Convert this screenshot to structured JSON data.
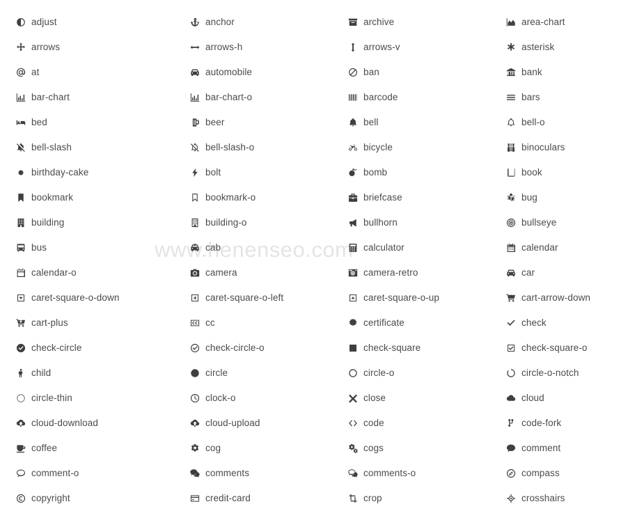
{
  "page": {
    "title": "Font Awesome icon cheatsheet",
    "background_color": "#ffffff",
    "text_color": "#4b4b4b",
    "icon_color": "#3f3f3f",
    "columns": 4,
    "rows": 20
  },
  "watermark": {
    "text": "www.henenseo.com",
    "color": "#e4e4e4"
  },
  "icons": [
    {
      "name": "adjust",
      "glyph": "adjust-icon",
      "row": 1,
      "col": 1
    },
    {
      "name": "anchor",
      "glyph": "anchor-icon",
      "row": 1,
      "col": 2
    },
    {
      "name": "archive",
      "glyph": "archive-icon",
      "row": 1,
      "col": 3
    },
    {
      "name": "area-chart",
      "glyph": "area-chart-icon",
      "row": 1,
      "col": 4
    },
    {
      "name": "arrows",
      "glyph": "arrows-icon",
      "row": 2,
      "col": 1
    },
    {
      "name": "arrows-h",
      "glyph": "arrows-h-icon",
      "row": 2,
      "col": 2
    },
    {
      "name": "arrows-v",
      "glyph": "arrows-v-icon",
      "row": 2,
      "col": 3
    },
    {
      "name": "asterisk",
      "glyph": "asterisk-icon",
      "row": 2,
      "col": 4
    },
    {
      "name": "at",
      "glyph": "at-icon",
      "row": 3,
      "col": 1
    },
    {
      "name": "automobile",
      "glyph": "automobile-icon",
      "row": 3,
      "col": 2
    },
    {
      "name": "ban",
      "glyph": "ban-icon",
      "row": 3,
      "col": 3
    },
    {
      "name": "bank",
      "glyph": "bank-icon",
      "row": 3,
      "col": 4
    },
    {
      "name": "bar-chart",
      "glyph": "bar-chart-icon",
      "row": 4,
      "col": 1
    },
    {
      "name": "bar-chart-o",
      "glyph": "bar-chart-o-icon",
      "row": 4,
      "col": 2
    },
    {
      "name": "barcode",
      "glyph": "barcode-icon",
      "row": 4,
      "col": 3
    },
    {
      "name": "bars",
      "glyph": "bars-icon",
      "row": 4,
      "col": 4
    },
    {
      "name": "bed",
      "glyph": "bed-icon",
      "row": 5,
      "col": 1
    },
    {
      "name": "beer",
      "glyph": "beer-icon",
      "row": 5,
      "col": 2
    },
    {
      "name": "bell",
      "glyph": "bell-icon",
      "row": 5,
      "col": 3
    },
    {
      "name": "bell-o",
      "glyph": "bell-o-icon",
      "row": 5,
      "col": 4
    },
    {
      "name": "bell-slash",
      "glyph": "bell-slash-icon",
      "row": 6,
      "col": 1
    },
    {
      "name": "bell-slash-o",
      "glyph": "bell-slash-o-icon",
      "row": 6,
      "col": 2
    },
    {
      "name": "bicycle",
      "glyph": "bicycle-icon",
      "row": 6,
      "col": 3
    },
    {
      "name": "binoculars",
      "glyph": "binoculars-icon",
      "row": 6,
      "col": 4
    },
    {
      "name": "birthday-cake",
      "glyph": "birthday-cake-icon",
      "row": 7,
      "col": 1
    },
    {
      "name": "bolt",
      "glyph": "bolt-icon",
      "row": 7,
      "col": 2
    },
    {
      "name": "bomb",
      "glyph": "bomb-icon",
      "row": 7,
      "col": 3
    },
    {
      "name": "book",
      "glyph": "book-icon",
      "row": 7,
      "col": 4
    },
    {
      "name": "bookmark",
      "glyph": "bookmark-icon",
      "row": 8,
      "col": 1
    },
    {
      "name": "bookmark-o",
      "glyph": "bookmark-o-icon",
      "row": 8,
      "col": 2
    },
    {
      "name": "briefcase",
      "glyph": "briefcase-icon",
      "row": 8,
      "col": 3
    },
    {
      "name": "bug",
      "glyph": "bug-icon",
      "row": 8,
      "col": 4
    },
    {
      "name": "building",
      "glyph": "building-icon",
      "row": 9,
      "col": 1
    },
    {
      "name": "building-o",
      "glyph": "building-o-icon",
      "row": 9,
      "col": 2
    },
    {
      "name": "bullhorn",
      "glyph": "bullhorn-icon",
      "row": 9,
      "col": 3
    },
    {
      "name": "bullseye",
      "glyph": "bullseye-icon",
      "row": 9,
      "col": 4
    },
    {
      "name": "bus",
      "glyph": "bus-icon",
      "row": 10,
      "col": 1
    },
    {
      "name": "cab",
      "glyph": "cab-icon",
      "row": 10,
      "col": 2
    },
    {
      "name": "calculator",
      "glyph": "calculator-icon",
      "row": 10,
      "col": 3
    },
    {
      "name": "calendar",
      "glyph": "calendar-icon",
      "row": 10,
      "col": 4
    },
    {
      "name": "calendar-o",
      "glyph": "calendar-o-icon",
      "row": 11,
      "col": 1
    },
    {
      "name": "camera",
      "glyph": "camera-icon",
      "row": 11,
      "col": 2
    },
    {
      "name": "camera-retro",
      "glyph": "camera-retro-icon",
      "row": 11,
      "col": 3
    },
    {
      "name": "car",
      "glyph": "car-icon",
      "row": 11,
      "col": 4
    },
    {
      "name": "caret-square-o-down",
      "glyph": "caret-square-o-down-icon",
      "row": 12,
      "col": 1
    },
    {
      "name": "caret-square-o-left",
      "glyph": "caret-square-o-left-icon",
      "row": 12,
      "col": 2
    },
    {
      "name": "caret-square-o-up",
      "glyph": "caret-square-o-up-icon",
      "row": 12,
      "col": 3
    },
    {
      "name": "cart-arrow-down",
      "glyph": "cart-arrow-down-icon",
      "row": 12,
      "col": 4
    },
    {
      "name": "cart-plus",
      "glyph": "cart-plus-icon",
      "row": 13,
      "col": 1
    },
    {
      "name": "cc",
      "glyph": "cc-icon",
      "row": 13,
      "col": 2
    },
    {
      "name": "certificate",
      "glyph": "certificate-icon",
      "row": 13,
      "col": 3
    },
    {
      "name": "check",
      "glyph": "check-icon",
      "row": 13,
      "col": 4
    },
    {
      "name": "check-circle",
      "glyph": "check-circle-icon",
      "row": 14,
      "col": 1
    },
    {
      "name": "check-circle-o",
      "glyph": "check-circle-o-icon",
      "row": 14,
      "col": 2
    },
    {
      "name": "check-square",
      "glyph": "check-square-icon",
      "row": 14,
      "col": 3
    },
    {
      "name": "check-square-o",
      "glyph": "check-square-o-icon",
      "row": 14,
      "col": 4
    },
    {
      "name": "child",
      "glyph": "child-icon",
      "row": 15,
      "col": 1
    },
    {
      "name": "circle",
      "glyph": "circle-icon",
      "row": 15,
      "col": 2
    },
    {
      "name": "circle-o",
      "glyph": "circle-o-icon",
      "row": 15,
      "col": 3
    },
    {
      "name": "circle-o-notch",
      "glyph": "circle-o-notch-icon",
      "row": 15,
      "col": 4
    },
    {
      "name": "circle-thin",
      "glyph": "circle-thin-icon",
      "row": 16,
      "col": 1
    },
    {
      "name": "clock-o",
      "glyph": "clock-o-icon",
      "row": 16,
      "col": 2
    },
    {
      "name": "close",
      "glyph": "close-icon",
      "row": 16,
      "col": 3
    },
    {
      "name": "cloud",
      "glyph": "cloud-icon",
      "row": 16,
      "col": 4
    },
    {
      "name": "cloud-download",
      "glyph": "cloud-download-icon",
      "row": 17,
      "col": 1
    },
    {
      "name": "cloud-upload",
      "glyph": "cloud-upload-icon",
      "row": 17,
      "col": 2
    },
    {
      "name": "code",
      "glyph": "code-icon",
      "row": 17,
      "col": 3
    },
    {
      "name": "code-fork",
      "glyph": "code-fork-icon",
      "row": 17,
      "col": 4
    },
    {
      "name": "coffee",
      "glyph": "coffee-icon",
      "row": 18,
      "col": 1
    },
    {
      "name": "cog",
      "glyph": "cog-icon",
      "row": 18,
      "col": 2
    },
    {
      "name": "cogs",
      "glyph": "cogs-icon",
      "row": 18,
      "col": 3
    },
    {
      "name": "comment",
      "glyph": "comment-icon",
      "row": 18,
      "col": 4
    },
    {
      "name": "comment-o",
      "glyph": "comment-o-icon",
      "row": 19,
      "col": 1
    },
    {
      "name": "comments",
      "glyph": "comments-icon",
      "row": 19,
      "col": 2
    },
    {
      "name": "comments-o",
      "glyph": "comments-o-icon",
      "row": 19,
      "col": 3
    },
    {
      "name": "compass",
      "glyph": "compass-icon",
      "row": 19,
      "col": 4
    },
    {
      "name": "copyright",
      "glyph": "copyright-icon",
      "row": 20,
      "col": 1
    },
    {
      "name": "credit-card",
      "glyph": "credit-card-icon",
      "row": 20,
      "col": 2
    },
    {
      "name": "crop",
      "glyph": "crop-icon",
      "row": 20,
      "col": 3
    },
    {
      "name": "crosshairs",
      "glyph": "crosshairs-icon",
      "row": 20,
      "col": 4
    }
  ]
}
